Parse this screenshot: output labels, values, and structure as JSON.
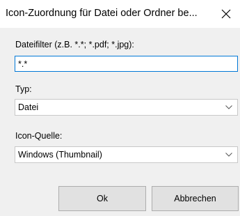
{
  "window": {
    "title": "Icon-Zuordnung für Datei oder Ordner be...",
    "close_icon": "close-icon"
  },
  "filter": {
    "label": "Dateifilter (z.B. *.*; *.pdf; *.jpg):",
    "value": "*.*"
  },
  "type": {
    "label": "Typ:",
    "selected": "Datei"
  },
  "icon_source": {
    "label": "Icon-Quelle:",
    "selected": "Windows (Thumbnail)"
  },
  "buttons": {
    "ok_label": "Ok",
    "cancel_label": "Abbrechen"
  },
  "colors": {
    "focus_border": "#0078d7",
    "dialog_background": "#f0f0f0",
    "button_face": "#e1e1e1"
  }
}
